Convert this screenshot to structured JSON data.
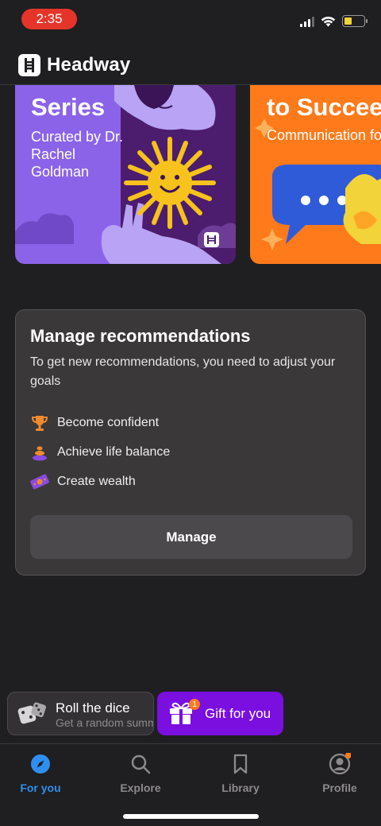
{
  "status_bar": {
    "time": "2:35"
  },
  "header": {
    "app_name": "Headway"
  },
  "carousel": [
    {
      "title": "Series",
      "subtitle": "Curated by Dr. Rachel Goldman"
    },
    {
      "title": "to Succeed",
      "subtitle": "Communication for Every Career"
    }
  ],
  "manage": {
    "title": "Manage recommendations",
    "description": "To get new recommendations, you need to adjust your goals",
    "goals": [
      {
        "label": "Become confident",
        "icon": "trophy-icon"
      },
      {
        "label": "Achieve life balance",
        "icon": "balance-stones-icon"
      },
      {
        "label": "Create wealth",
        "icon": "money-icon"
      }
    ],
    "button": "Manage"
  },
  "chips": {
    "dice_title": "Roll the dice",
    "dice_sub": "Get a random summary",
    "gift_label": "Gift for you",
    "gift_badge": "1"
  },
  "tabs": [
    {
      "label": "For you",
      "icon": "compass-icon",
      "active": true
    },
    {
      "label": "Explore",
      "icon": "search-icon"
    },
    {
      "label": "Library",
      "icon": "bookmark-icon"
    },
    {
      "label": "Profile",
      "icon": "profile-icon"
    }
  ],
  "colors": {
    "accent": "#2e8ff0",
    "gift": "#7a0fe0",
    "orange": "#ff7a1a",
    "purple": "#8b63e8"
  }
}
